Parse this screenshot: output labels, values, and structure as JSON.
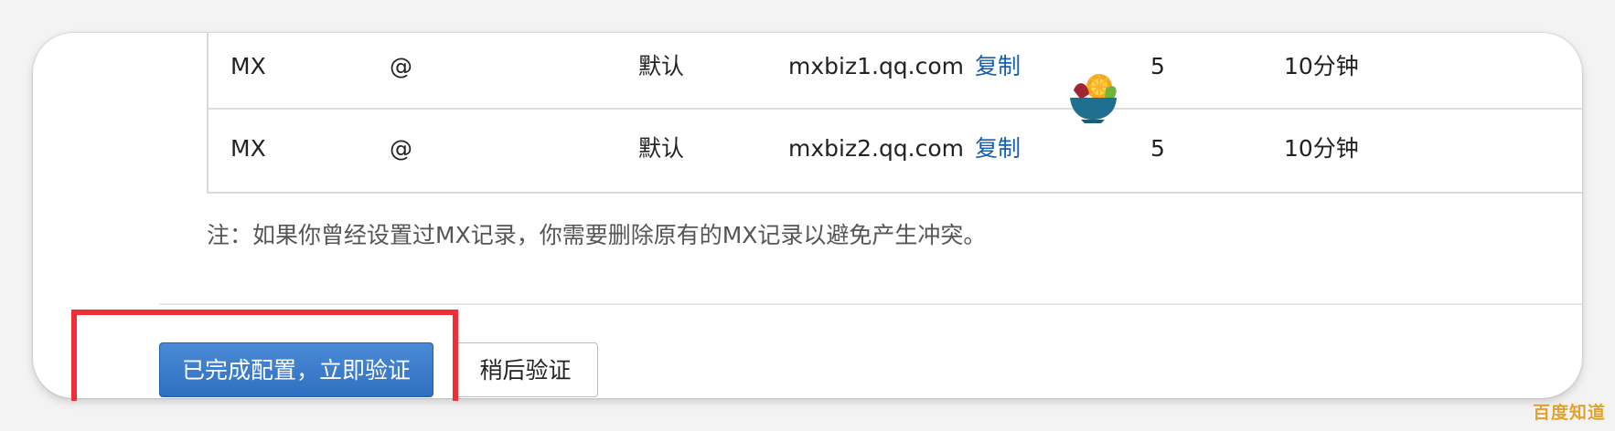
{
  "table": {
    "rows": [
      {
        "type": "MX",
        "host": "@",
        "line": "默认",
        "value": "mxbiz1.qq.com",
        "copy_label": "复制",
        "priority": "5",
        "ttl": "10分钟"
      },
      {
        "type": "MX",
        "host": "@",
        "line": "默认",
        "value": "mxbiz2.qq.com",
        "copy_label": "复制",
        "priority": "5",
        "ttl": "10分钟"
      }
    ]
  },
  "notice": {
    "text": "注：如果你曾经设置过MX记录，你需要删除原有的MX记录以避免产生冲突。"
  },
  "actions": {
    "primary_label": "已完成配置，立即验证",
    "secondary_label": "稍后验证"
  },
  "watermark": {
    "text": "百度知道"
  },
  "icons": {
    "fruit_bowl": "fruit-bowl-icon"
  },
  "colors": {
    "link": "#155fb3",
    "primary_button": "#2f70c1",
    "highlight": "#ef2f35",
    "watermark": "#e2a12e"
  }
}
